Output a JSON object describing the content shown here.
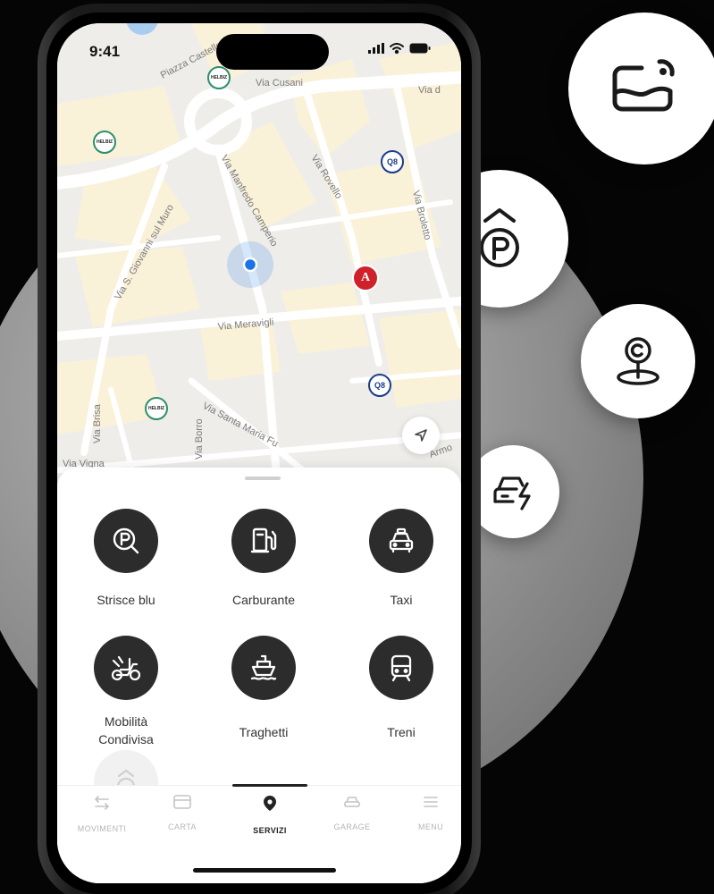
{
  "status_bar": {
    "time": "9:41"
  },
  "map": {
    "streets": [
      "Piazza Castello",
      "Via Cusani",
      "Via d",
      "Via Rovello",
      "Via Broletto",
      "Via Manfredo Camperio",
      "Via S. Giovanni sul Muro",
      "Via Meravigli",
      "Via Brisa",
      "Via Borro",
      "Via Santa Maria Fu",
      "Via Vigna",
      "Armo"
    ],
    "poi_labels": {
      "helbiz": "HELBIZ",
      "q8": "Q8",
      "autogrill": "A"
    },
    "colors": {
      "base": "#eeedea",
      "block": "#faf1d9",
      "road": "#ffffff",
      "user_dot": "#1a73e8",
      "helbiz": "#2e8f6a",
      "autogrill": "#d0202a",
      "q8": "#1b3c8c"
    }
  },
  "services": [
    {
      "label": "Strisce blu",
      "icon": "parking-search-icon"
    },
    {
      "label": "Carburante",
      "icon": "fuel-pump-icon"
    },
    {
      "label": "Taxi",
      "icon": "taxi-icon"
    },
    {
      "label": "Mobilità Condivisa",
      "icon": "scooter-icon"
    },
    {
      "label": "Traghetti",
      "icon": "ferry-icon"
    },
    {
      "label": "Treni",
      "icon": "train-icon"
    },
    {
      "label": "",
      "icon": "parking-up-icon"
    }
  ],
  "tabs": [
    {
      "label": "MOVIMENTI",
      "icon": "arrows-exchange-icon",
      "active": false
    },
    {
      "label": "CARTA",
      "icon": "card-icon",
      "active": false
    },
    {
      "label": "SERVIZI",
      "icon": "location-pin-icon",
      "active": true
    },
    {
      "label": "GARAGE",
      "icon": "car-icon",
      "active": false
    },
    {
      "label": "MENU",
      "icon": "menu-icon",
      "active": false
    }
  ],
  "floating_features": [
    {
      "icon": "car-wash-icon"
    },
    {
      "icon": "parking-up-icon"
    },
    {
      "icon": "copyright-location-icon"
    },
    {
      "icon": "ev-car-icon"
    }
  ],
  "colors": {
    "background": "#050505",
    "service_icon_bg": "#2c2c2c",
    "tab_active": "#222222",
    "tab_inactive": "#b5b5b5"
  }
}
